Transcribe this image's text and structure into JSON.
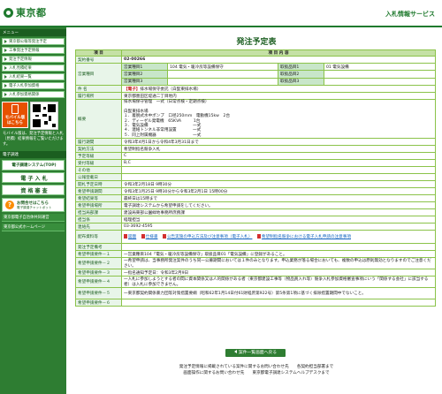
{
  "header": {
    "logo_text": "東京都",
    "service_title": "入札情報サービス"
  },
  "sidebar": {
    "section1": "メニュー",
    "items": [
      "東京都公報等発注予定",
      "工事発注予定情報",
      "発注予定情報",
      "入札見積結果",
      "入札結果一覧",
      "電子入札参加資格",
      "入札参加資格関係"
    ],
    "mobile_label": "モバイル版",
    "mobile_sub": "はこちら",
    "mobile_note": "モバイル版は、発注予定情報と入札（見積）結果情報をご覧いただけます。",
    "section2": "電子調達",
    "big_items": [
      "電子調達システム(TOP)",
      "電 子 入 札",
      "資 格 審 査"
    ],
    "info_label": "お問合せはこちら",
    "info_sub": "電子調達チャットボット",
    "links": [
      "東京都電子自治体共同運営",
      "東京都公式ホームページ"
    ]
  },
  "main": {
    "title": "発注予定表",
    "col_item": "項 目",
    "col_content": "項 目 内 容",
    "rows": [
      {
        "label": "契約番号",
        "value": "02-00266"
      }
    ],
    "business": {
      "label": "営業種目",
      "k1": "営業種目1",
      "v1": "104 電気・暖冷房等設備保守",
      "k2": "営業種目2",
      "v2": "",
      "k3": "営業種目3",
      "v3": "",
      "c1": "取扱品目1",
      "cv1": "01 電気設備",
      "c2": "取扱品目2",
      "cv2": "",
      "c3": "取扱品目3",
      "cv3": ""
    },
    "name_label": "件 名",
    "name_tag": "【電子】",
    "name_value": "排水場保守委託（白髭東排水場）",
    "place_label": "履行場所",
    "place_value": "東京都墨田区堤通二丁目地内",
    "outline_label": "概要",
    "outline_value": "排水場保守管理　一式（日常点検・定期点検）\n\n白髭東排水場\n１．着脱式水中ポンプ　口径250mm　電動機15kw　2台\n２．ディーゼル発電機　65KVA　　　1台\n３．電気設備　　　　　　　　　　　一式\n４．連絡トンネル非常用設置　　　　一式\n５．同上附属機器　　　　　　　　　一式",
    "rows2": [
      {
        "label": "履行期間",
        "value": "令和3年4月1日から令和4年3月31日まで"
      },
      {
        "label": "契約方法",
        "value": "希望制指名競争入札"
      },
      {
        "label": "予定等級",
        "value": "C"
      },
      {
        "label": "受付等級",
        "value": "B,C"
      },
      {
        "label": "その他",
        "value": ""
      },
      {
        "label": "公報登載日",
        "value": ""
      },
      {
        "label": "開札予定日時",
        "value": "令和3年2月18日 9時30分"
      },
      {
        "label": "希望申請期間",
        "value": "令和3年1月25日 9時30分から令和3年2月1日 15時00分"
      },
      {
        "label": "希望結果等",
        "value": "最終日は15時まで"
      },
      {
        "label": "希望申請場所",
        "value": "電子調達システムから希望申請をしてください。"
      },
      {
        "label": "担当局部課",
        "value": "建設局東部公園緑地事務所庶務課"
      },
      {
        "label": "担当係",
        "value": "経理担当"
      },
      {
        "label": "連絡先",
        "value": "03-3692-4595"
      }
    ],
    "attach_label": "配布資料等",
    "attach_links": [
      "図面",
      "仕様書",
      "公告実施の申込方法及び注意事項（電子入札）",
      "希望制指名競争における電子入札申請の注意事項"
    ],
    "rows3": [
      {
        "label": "発注予定備考",
        "value": ""
      },
      {
        "label": "希望申請要件－１",
        "value": "一営業種目104「電気・暖冷房等設備保守」取扱品目01「電気設備」に登録があること。"
      },
      {
        "label": "希望申請要件－２",
        "value": "一希望申請は、当事務所発注案件のうち同一公募期間においては１件のみとなります。申込業務が落る場合においても、複数の申込は原則無効となりますのでご注意ください。"
      },
      {
        "label": "希望申請要件－３",
        "value": "一指名通知予定日：令和3年2月9日"
      },
      {
        "label": "希望申請要件－４",
        "value": "一入札に参加しようとする者の間に資本関係又は人的関係がある者（東京都建設工事等（物品買入れ等）競争入札参加資格審査事項にいう「関係する会社」に該当する者）は入札に参加できません。"
      },
      {
        "label": "希望申請要件－５",
        "value": "一東京都契約関係暴力団等対策措置要綱（昭和62年1月14日付61財経庶第922号）第5条第1項に基づく排除措置期間中でないこと。"
      },
      {
        "label": "希望申請要件－６",
        "value": ""
      }
    ],
    "back_button": "案件一覧画面へ戻る"
  },
  "footer": {
    "line1": "発注予定情報に掲載されている案件に関するお問い合わせ先　　各契約担当部署まで",
    "line2": "画面操作に関するお問い合わせ先　　東京都電子調達システムヘルプデスクまで"
  }
}
